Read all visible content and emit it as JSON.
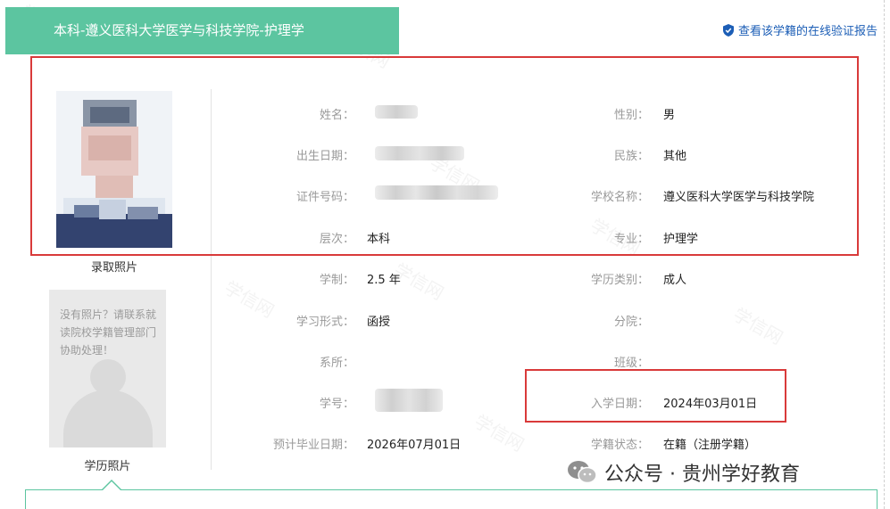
{
  "header": {
    "title": "本科-遵义医科大学医学与科技学院-护理学",
    "verify_link": "查看该学籍的在线验证报告",
    "verify_icon": "shield-check-icon"
  },
  "photos": {
    "admission_caption": "录取照片",
    "education_caption": "学历照片",
    "no_photo_text": "没有照片？请联系就读院校学籍管理部门协助处理！"
  },
  "fields": {
    "name_label": "姓名：",
    "gender_label": "性别：",
    "gender_value": "男",
    "birth_label": "出生日期：",
    "ethnic_label": "民族：",
    "ethnic_value": "其他",
    "id_label": "证件号码：",
    "school_label": "学校名称：",
    "school_value": "遵义医科大学医学与科技学院",
    "level_label": "层次：",
    "level_value": "本科",
    "major_label": "专业：",
    "major_value": "护理学",
    "duration_label": "学制：",
    "duration_value": "2.5 年",
    "edu_type_label": "学历类别：",
    "edu_type_value": "成人",
    "study_form_label": "学习形式：",
    "study_form_value": "函授",
    "branch_label": "分院：",
    "branch_value": "",
    "department_label": "系所：",
    "department_value": "",
    "class_label": "班级：",
    "class_value": "",
    "student_no_label": "学号：",
    "enroll_date_label": "入学日期：",
    "enroll_date_value": "2024年03月01日",
    "grad_date_label": "预计毕业日期：",
    "grad_date_value": "2026年07月01日",
    "status_label": "学籍状态：",
    "status_value": "在籍（注册学籍）"
  },
  "watermark_text": "学信网",
  "footer": {
    "wechat_text": "公众号 · 贵州学好教育",
    "wechat_icon": "wechat-icon"
  },
  "colors": {
    "accent": "#5cc5a0",
    "highlight_box": "#d93a3a",
    "link": "#1c5eb6"
  }
}
